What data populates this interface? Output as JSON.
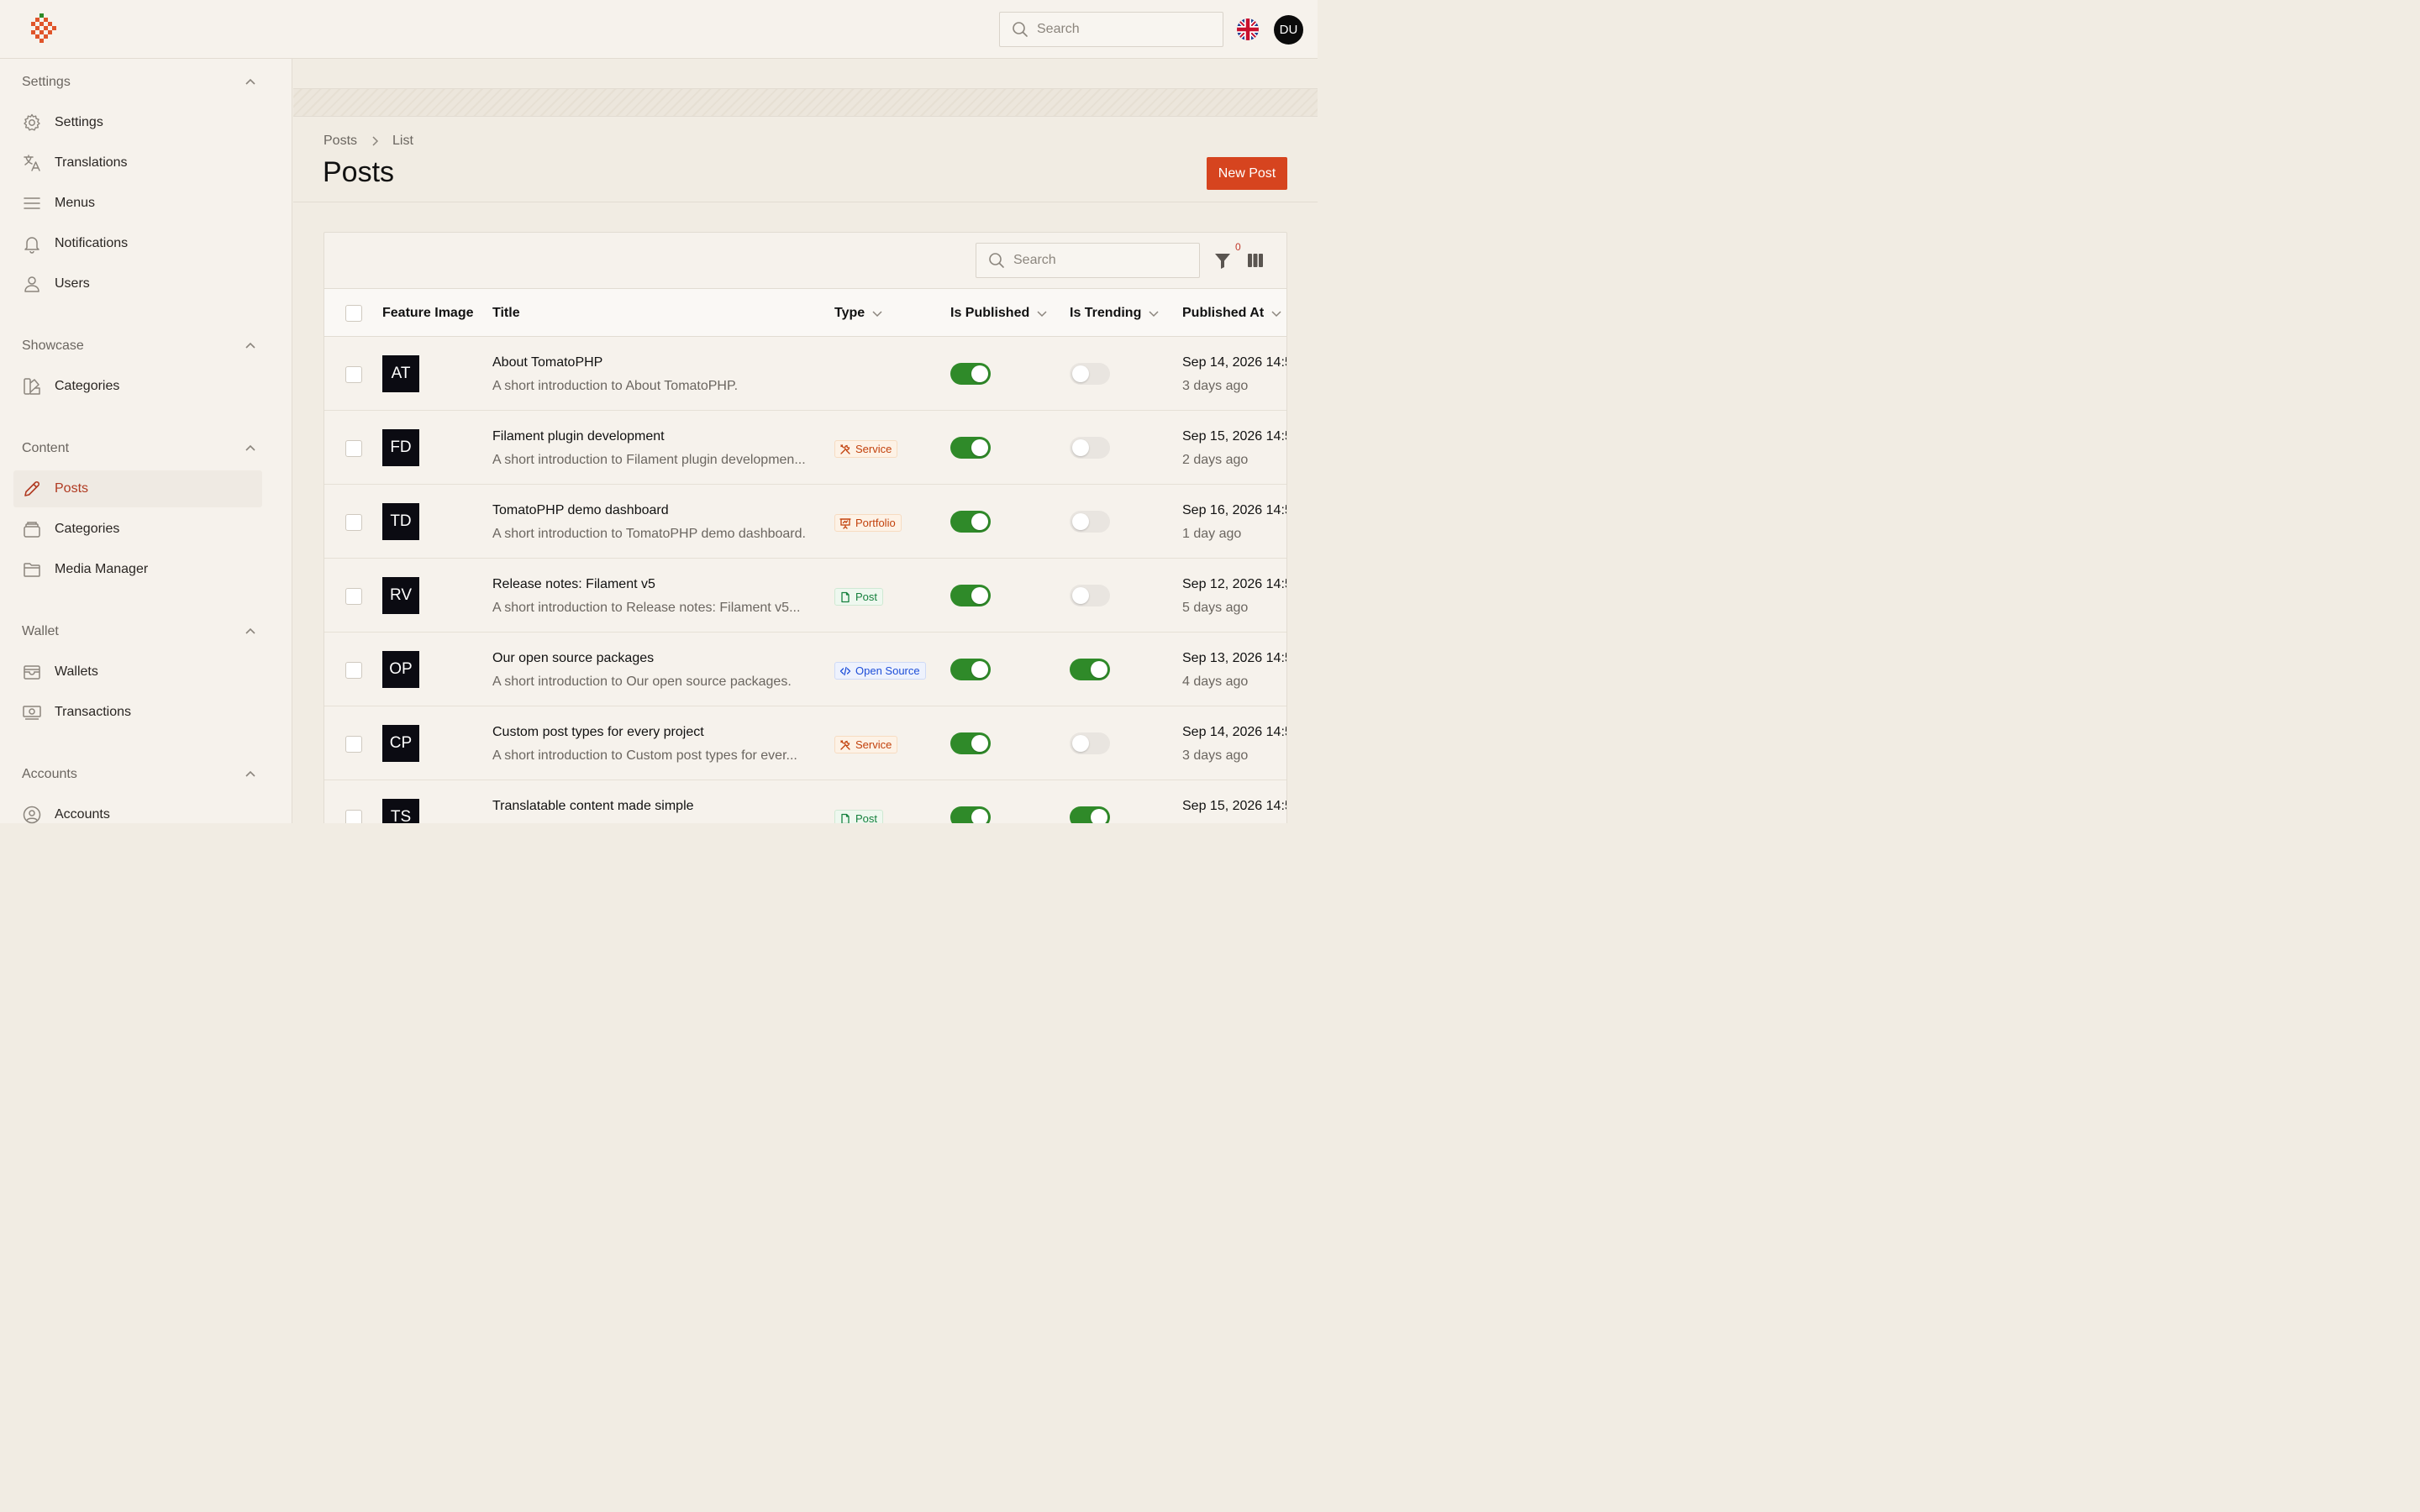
{
  "topbar": {
    "search_placeholder": "Search",
    "avatar_initials": "DU",
    "brand_color": "#d6441f"
  },
  "sidebar": {
    "groups": [
      {
        "label": "Settings",
        "items": [
          {
            "label": "Settings",
            "icon": "cog-icon"
          },
          {
            "label": "Translations",
            "icon": "translate-icon"
          },
          {
            "label": "Menus",
            "icon": "menu-lines-icon"
          },
          {
            "label": "Notifications",
            "icon": "bell-icon"
          },
          {
            "label": "Users",
            "icon": "user-icon"
          }
        ]
      },
      {
        "label": "Showcase",
        "items": [
          {
            "label": "Categories",
            "icon": "swatch-icon"
          }
        ]
      },
      {
        "label": "Content",
        "items": [
          {
            "label": "Posts",
            "icon": "pencil-icon",
            "active": true
          },
          {
            "label": "Categories",
            "icon": "stack-icon"
          },
          {
            "label": "Media Manager",
            "icon": "folder-icon"
          }
        ]
      },
      {
        "label": "Wallet",
        "items": [
          {
            "label": "Wallets",
            "icon": "wallet-icon"
          },
          {
            "label": "Transactions",
            "icon": "banknote-icon"
          }
        ]
      },
      {
        "label": "Accounts",
        "items": [
          {
            "label": "Accounts",
            "icon": "user-circle-icon"
          }
        ]
      }
    ]
  },
  "header": {
    "breadcrumbs": [
      "Posts",
      "List"
    ],
    "title": "Posts",
    "new_button": "New Post"
  },
  "table": {
    "search_placeholder": "Search",
    "filter_count": "0",
    "columns": [
      "Feature Image",
      "Title",
      "Type",
      "Is Published",
      "Is Trending",
      "Published At"
    ],
    "rows": [
      {
        "initials": "AT",
        "title": "About TomatoPHP",
        "subtitle": "A short introduction to About TomatoPHP.",
        "type": "",
        "type_color": "",
        "published": true,
        "trending": false,
        "date": "Sep 14, 2026 14:5",
        "relative": "3 days ago"
      },
      {
        "initials": "FD",
        "title": "Filament plugin development",
        "subtitle": "A short introduction to Filament plugin developmen...",
        "type": "Service",
        "type_color": "orange",
        "published": true,
        "trending": false,
        "date": "Sep 15, 2026 14:5",
        "relative": "2 days ago"
      },
      {
        "initials": "TD",
        "title": "TomatoPHP demo dashboard",
        "subtitle": "A short introduction to TomatoPHP demo dashboard.",
        "type": "Portfolio",
        "type_color": "orange",
        "published": true,
        "trending": false,
        "date": "Sep 16, 2026 14:5",
        "relative": "1 day ago"
      },
      {
        "initials": "RV",
        "title": "Release notes: Filament v5",
        "subtitle": "A short introduction to Release notes: Filament v5...",
        "type": "Post",
        "type_color": "green",
        "published": true,
        "trending": false,
        "date": "Sep 12, 2026 14:5",
        "relative": "5 days ago"
      },
      {
        "initials": "OP",
        "title": "Our open source packages",
        "subtitle": "A short introduction to Our open source packages.",
        "type": "Open Source",
        "type_color": "blue",
        "published": true,
        "trending": true,
        "date": "Sep 13, 2026 14:5",
        "relative": "4 days ago"
      },
      {
        "initials": "CP",
        "title": "Custom post types for every project",
        "subtitle": "A short introduction to Custom post types for ever...",
        "type": "Service",
        "type_color": "orange",
        "published": true,
        "trending": false,
        "date": "Sep 14, 2026 14:5",
        "relative": "3 days ago"
      },
      {
        "initials": "TS",
        "title": "Translatable content made simple",
        "subtitle": "",
        "type": "Post",
        "type_color": "green",
        "published": true,
        "trending": true,
        "date": "Sep 15, 2026 14:5",
        "relative": ""
      }
    ]
  }
}
